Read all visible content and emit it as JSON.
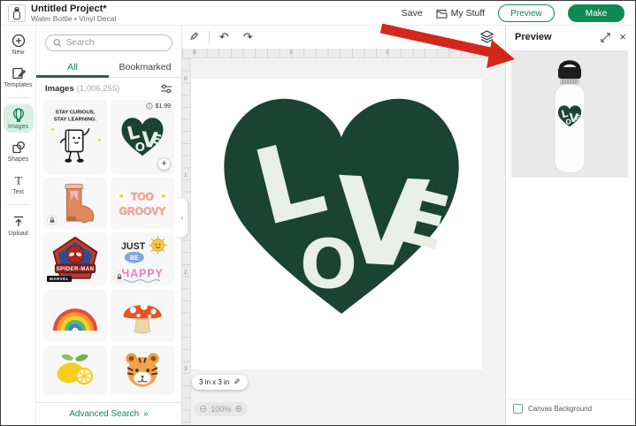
{
  "header": {
    "title": "Untitled Project*",
    "subtitle": "Water Bottle • Vinyl Decal",
    "actions": {
      "save": "Save",
      "my_stuff": "My Stuff",
      "preview": "Preview",
      "make": "Make"
    }
  },
  "nav_rail": {
    "active_item": "Images",
    "items": [
      {
        "label": "New",
        "icon": "plus-circle-icon"
      },
      {
        "label": "Templates",
        "icon": "template-icon"
      },
      {
        "label": "Images",
        "icon": "images-balloon-icon"
      },
      {
        "label": "Shapes",
        "icon": "shapes-icon"
      },
      {
        "label": "Text",
        "icon": "text-icon"
      },
      {
        "label": "Upload",
        "icon": "upload-icon"
      }
    ]
  },
  "images_panel": {
    "search_placeholder": "Search",
    "tabs": [
      {
        "label": "All",
        "active": true
      },
      {
        "label": "Bookmarked",
        "active": false
      }
    ],
    "results_label": "Images",
    "results_count": "(1,006,255)",
    "tiles": [
      {
        "name": "stay-curious-sticker",
        "text_top": "STAY CURIOUS,",
        "text_bottom": "STAY LEARNING."
      },
      {
        "name": "love-heart-sticker",
        "price": "$1.99",
        "has_add_button": true
      },
      {
        "name": "cowboy-boot-sticker",
        "locked": true
      },
      {
        "name": "groovy-sticker",
        "text_top": "TOO",
        "text_bottom": "GROOVY"
      },
      {
        "name": "spider-man-sticker",
        "banner": "SPIDER-MAN",
        "brand": "MARVEL"
      },
      {
        "name": "just-be-happy-sticker",
        "word1": "JUST",
        "word2": "BE",
        "word3": "HAPPY",
        "locked": true
      },
      {
        "name": "rainbow-sticker"
      },
      {
        "name": "mushroom-sticker"
      },
      {
        "name": "lemons-sticker"
      },
      {
        "name": "tiger-sticker"
      }
    ],
    "advanced_search": "Advanced Search",
    "advanced_search_chevrons": "»"
  },
  "canvas": {
    "toolbar_icons": [
      "pencil-icon",
      "undo-icon",
      "redo-icon",
      "layers-icon"
    ],
    "h_ruler": [
      "0",
      "1",
      "2"
    ],
    "v_ruler": [
      "0",
      "1",
      "2",
      "3"
    ],
    "design_name": "LOVE heart vinyl decal",
    "design_letters": [
      "L",
      "O",
      "V",
      "E"
    ],
    "size_chip": "3 in x 3 in",
    "zoom_level": "100%"
  },
  "preview_panel": {
    "title": "Preview",
    "product": "white water bottle with LOVE heart decal",
    "canvas_background_label": "Canvas Background",
    "checkbox_checked": false
  },
  "colors": {
    "brand_green": "#0f8a52",
    "active_nav_bg": "#d8efe3",
    "tab_underline": "#3c5a50",
    "heart_green": "#1b4334",
    "heart_letters": "#e7efe7",
    "arrow_red": "#d3271c"
  }
}
